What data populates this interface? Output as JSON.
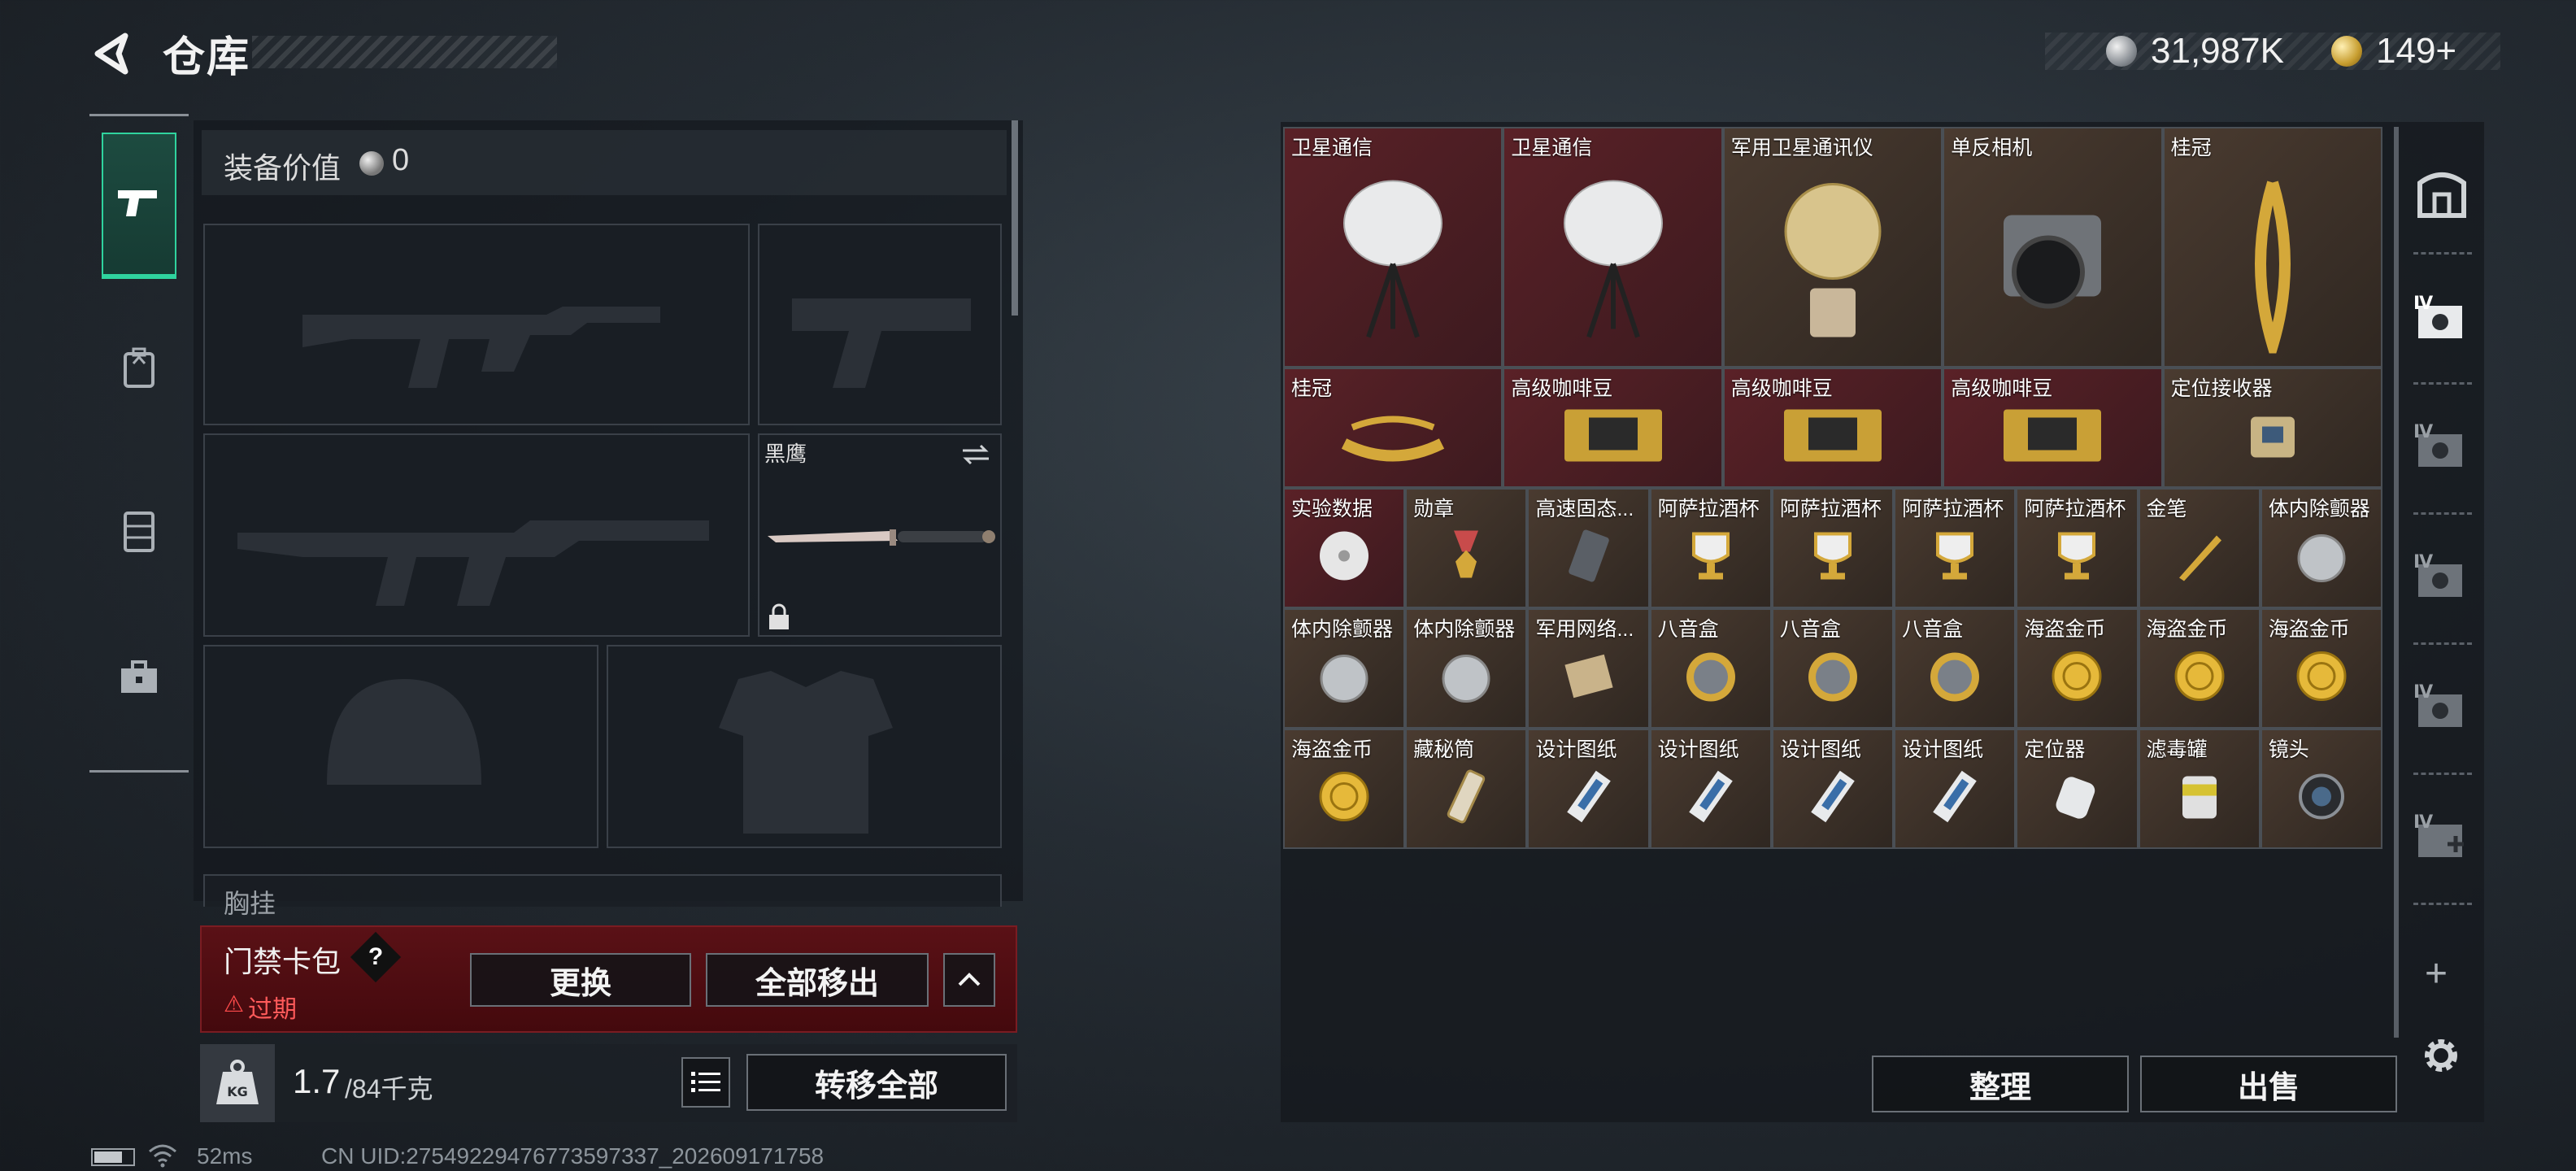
{
  "header": {
    "title": "仓库",
    "money": "31,987K",
    "tokens": "149+"
  },
  "loadout": {
    "equip_value_label": "装备价值",
    "equip_value": "0",
    "melee_name": "黑鹰",
    "chest_label": "胸挂"
  },
  "keycard": {
    "title": "门禁卡包",
    "help": "?",
    "status": "过期",
    "status_icon": "⚠",
    "replace_label": "更换",
    "remove_all_label": "全部移出"
  },
  "weight": {
    "current": "1.7",
    "max": "/84千克",
    "transfer_all_label": "转移全部"
  },
  "storage": {
    "items": [
      {
        "name": "卫星通信",
        "rarity": "red",
        "icon": "satellite-dish-icon"
      },
      {
        "name": "卫星通信",
        "rarity": "red",
        "icon": "satellite-dish-icon"
      },
      {
        "name": "军用卫星通讯仪",
        "rarity": "gold",
        "icon": "satellite-comm-icon"
      },
      {
        "name": "单反相机",
        "rarity": "gold",
        "icon": "camera-icon"
      },
      {
        "name": "桂冠",
        "rarity": "gold",
        "icon": "laurel-icon"
      },
      {
        "name": "桂冠",
        "rarity": "red",
        "icon": "laurel-crown-icon"
      },
      {
        "name": "高级咖啡豆",
        "rarity": "red",
        "icon": "coffee-beans-icon"
      },
      {
        "name": "高级咖啡豆",
        "rarity": "red",
        "icon": "coffee-beans-icon"
      },
      {
        "name": "高级咖啡豆",
        "rarity": "red",
        "icon": "coffee-beans-icon"
      },
      {
        "name": "定位接收器",
        "rarity": "gold",
        "icon": "locator-receiver-icon"
      },
      {
        "name": "实验数据",
        "rarity": "red",
        "icon": "disc-icon"
      },
      {
        "name": "勋章",
        "rarity": "gold",
        "icon": "medal-icon"
      },
      {
        "name": "高速固态...",
        "rarity": "gold",
        "icon": "ssd-icon"
      },
      {
        "name": "阿萨拉酒杯",
        "rarity": "gold",
        "icon": "goblet-icon"
      },
      {
        "name": "阿萨拉酒杯",
        "rarity": "gold",
        "icon": "goblet-icon"
      },
      {
        "name": "阿萨拉酒杯",
        "rarity": "gold",
        "icon": "goblet-icon"
      },
      {
        "name": "阿萨拉酒杯",
        "rarity": "gold",
        "icon": "goblet-icon"
      },
      {
        "name": "金笔",
        "rarity": "gold",
        "icon": "pen-icon"
      },
      {
        "name": "体内除颤器",
        "rarity": "gold",
        "icon": "defibrillator-icon"
      },
      {
        "name": "体内除颤器",
        "rarity": "gold",
        "icon": "defibrillator-icon"
      },
      {
        "name": "体内除颤器",
        "rarity": "gold",
        "icon": "defibrillator-icon"
      },
      {
        "name": "军用网络...",
        "rarity": "gold",
        "icon": "network-module-icon"
      },
      {
        "name": "八音盒",
        "rarity": "gold",
        "icon": "music-box-icon"
      },
      {
        "name": "八音盒",
        "rarity": "gold",
        "icon": "music-box-icon"
      },
      {
        "name": "八音盒",
        "rarity": "gold",
        "icon": "music-box-icon"
      },
      {
        "name": "海盗金币",
        "rarity": "gold",
        "icon": "gold-coin-icon"
      },
      {
        "name": "海盗金币",
        "rarity": "gold",
        "icon": "gold-coin-icon"
      },
      {
        "name": "海盗金币",
        "rarity": "gold",
        "icon": "gold-coin-icon"
      },
      {
        "name": "海盗金币",
        "rarity": "gold",
        "icon": "gold-coin-icon"
      },
      {
        "name": "藏秘筒",
        "rarity": "gold",
        "icon": "cryptex-icon"
      },
      {
        "name": "设计图纸",
        "rarity": "gold",
        "icon": "blueprint-icon"
      },
      {
        "name": "设计图纸",
        "rarity": "gold",
        "icon": "blueprint-icon"
      },
      {
        "name": "设计图纸",
        "rarity": "gold",
        "icon": "blueprint-icon"
      },
      {
        "name": "设计图纸",
        "rarity": "gold",
        "icon": "blueprint-icon"
      },
      {
        "name": "定位器",
        "rarity": "gold",
        "icon": "locator-icon"
      },
      {
        "name": "滤毒罐",
        "rarity": "gold",
        "icon": "filter-canister-icon"
      },
      {
        "name": "镜头",
        "rarity": "gold",
        "icon": "lens-icon"
      }
    ],
    "sort_label": "整理",
    "sell_label": "出售"
  },
  "bag_tabs": [
    "Ⅳ",
    "Ⅳ",
    "Ⅳ",
    "Ⅳ",
    "Ⅳ"
  ],
  "footer": {
    "ping": "52ms",
    "uid": "CN UID:27549229476773597337_202609171758"
  },
  "colors": {
    "accent_green": "#2fd39e",
    "rarity_red": "#5a2127",
    "rarity_gold": "#4a3b30",
    "warning_red": "#ff5a5a"
  }
}
